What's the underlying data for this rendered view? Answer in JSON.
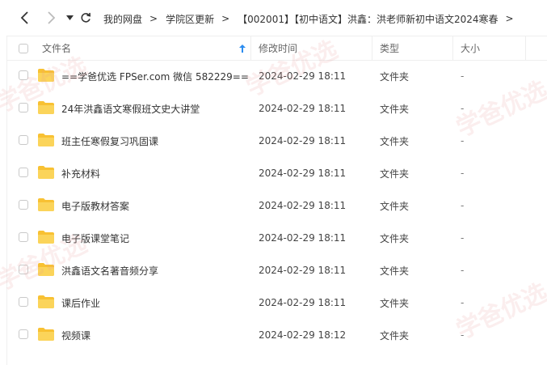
{
  "nav": {
    "back_icon": "chevron-left-icon",
    "forward_icon": "chevron-right-icon",
    "dropdown_icon": "triangle-down-icon",
    "refresh_icon": "refresh-icon"
  },
  "breadcrumb": [
    "我的网盘",
    "学院区更新",
    "【002001】【初中语文】洪鑫：洪老师新初中语文2024寒春"
  ],
  "columns": {
    "name": "文件名",
    "modified": "修改时间",
    "type": "类型",
    "size": "大小"
  },
  "accent_color": "#2b8cf0",
  "folder_color": "#f8c133",
  "files": [
    {
      "name": "==学爸优选 FPSer.com 微信 582229==",
      "modified": "2024-02-29 18:11",
      "type": "文件夹",
      "size": "-"
    },
    {
      "name": "24年洪鑫语文寒假班文史大讲堂",
      "modified": "2024-02-29 18:11",
      "type": "文件夹",
      "size": "-"
    },
    {
      "name": "班主任寒假复习巩固课",
      "modified": "2024-02-29 18:11",
      "type": "文件夹",
      "size": "-"
    },
    {
      "name": "补充材料",
      "modified": "2024-02-29 18:11",
      "type": "文件夹",
      "size": "-"
    },
    {
      "name": "电子版教材答案",
      "modified": "2024-02-29 18:11",
      "type": "文件夹",
      "size": "-"
    },
    {
      "name": "电子版课堂笔记",
      "modified": "2024-02-29 18:11",
      "type": "文件夹",
      "size": "-"
    },
    {
      "name": "洪鑫语文名著音频分享",
      "modified": "2024-02-29 18:11",
      "type": "文件夹",
      "size": "-"
    },
    {
      "name": "课后作业",
      "modified": "2024-02-29 18:11",
      "type": "文件夹",
      "size": "-"
    },
    {
      "name": "视频课",
      "modified": "2024-02-29 18:12",
      "type": "文件夹",
      "size": "-"
    }
  ],
  "watermark": "学爸优选"
}
